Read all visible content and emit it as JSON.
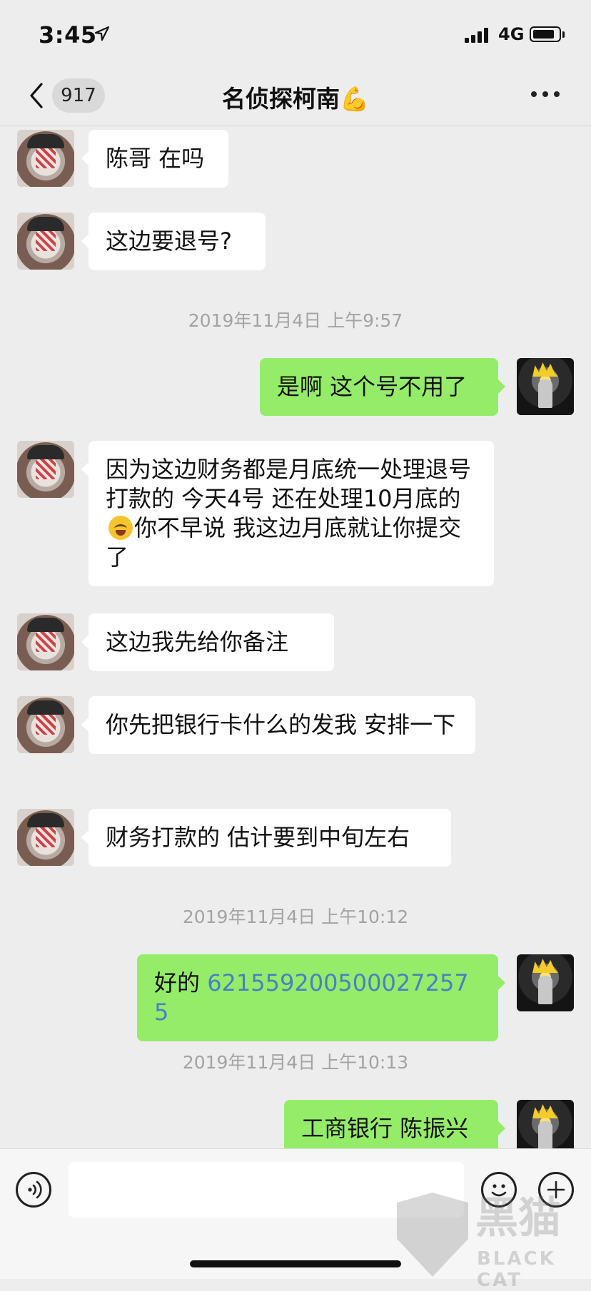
{
  "status_bar": {
    "time": "3:45",
    "network": "4G",
    "battery_level": 0.78,
    "signal_bars": 4
  },
  "nav": {
    "unread_count": "917",
    "title": "名侦探柯南💪"
  },
  "chat": {
    "messages": [
      {
        "side": "left",
        "text": "陈哥 在吗"
      },
      {
        "side": "left",
        "text": "这边要退号?"
      },
      {
        "type": "timestamp",
        "text": "2019年11月4日 上午9:57"
      },
      {
        "side": "right",
        "text": "是啊 这个号不用了"
      },
      {
        "side": "left",
        "text_a": "因为这边财务都是月底统一处理退号打款的 今天4号 还在处理10月底的 ",
        "emoji": "crying-laughing-emoji",
        "text_b": "你不早说 我这边月底就让你提交了"
      },
      {
        "side": "left",
        "text": "这边我先给你备注"
      },
      {
        "side": "left",
        "text": "你先把银行卡什么的发我 安排一下"
      },
      {
        "side": "left",
        "text": "财务打款的 估计要到中旬左右"
      },
      {
        "type": "timestamp",
        "text": "2019年11月4日 上午10:12"
      },
      {
        "side": "right",
        "text": "好的 ",
        "link": "6215592005000272575"
      },
      {
        "type": "timestamp",
        "text": "2019年11月4日 上午10:13"
      },
      {
        "side": "right",
        "text": "工商银行 陈振兴"
      }
    ]
  },
  "input_bar": {
    "placeholder": ""
  },
  "watermark": {
    "title": "黑猫",
    "subtitle": "BLACK CAT"
  },
  "colors": {
    "background": "#ededed",
    "outgoing_bubble": "#95ec69",
    "incoming_bubble": "#ffffff",
    "link": "#4b7fc3"
  }
}
